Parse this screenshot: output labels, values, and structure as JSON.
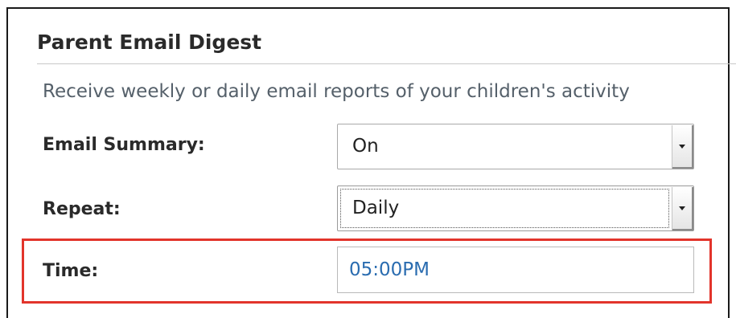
{
  "section": {
    "title": "Parent Email Digest",
    "description": "Receive weekly or daily email reports of your children's activity"
  },
  "form": {
    "email_summary": {
      "label": "Email Summary:",
      "selected": "On"
    },
    "repeat": {
      "label": "Repeat:",
      "selected": "Daily"
    },
    "time": {
      "label": "Time:",
      "value": "05:00PM"
    }
  },
  "colors": {
    "highlight_border": "#e2342b",
    "time_value_text": "#2a6cb0",
    "description_text": "#55606a"
  },
  "icons": {
    "select_arrow": "chevron-down-icon"
  }
}
